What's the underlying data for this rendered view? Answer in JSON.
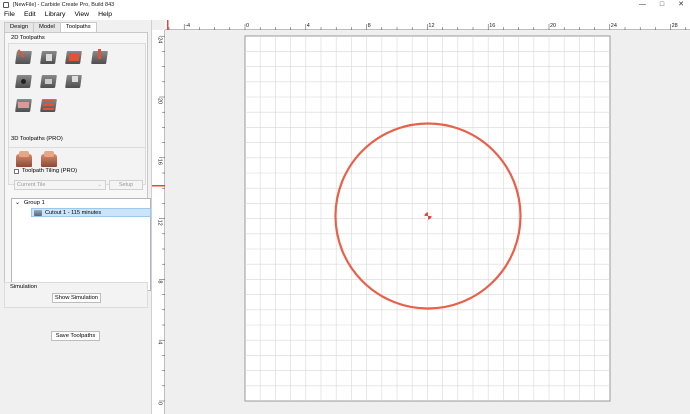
{
  "window": {
    "title": "[NewFile] - Carbide Create Pro, Build 843"
  },
  "menu": [
    "File",
    "Edit",
    "Library",
    "View",
    "Help"
  ],
  "tabs": [
    {
      "label": "Design"
    },
    {
      "label": "Model"
    },
    {
      "label": "Toolpaths",
      "active": true
    }
  ],
  "toolpaths_2d": {
    "label": "2D Toolpaths",
    "tools": [
      "contour-toolpath-icon",
      "pocket-toolpath-icon",
      "advanced-vcarve-icon",
      "vcarve-toolpath-icon",
      "drill-toolpath-icon",
      "rapid-adaptive-icon",
      "chamfer-toolpath-icon",
      "texture-toolpath-icon",
      "engrave-toolpath-icon",
      "thread-toolpath-icon"
    ]
  },
  "toolpaths_3d": {
    "label": "3D Toolpaths (PRO)",
    "tools": [
      "3d-rough-icon",
      "3d-finish-icon"
    ]
  },
  "tiling": {
    "label": "Toolpath Tiling (PRO)",
    "checked": false,
    "tile_value": "Current Tile",
    "setup_label": "Setup"
  },
  "tree": {
    "group_label": "Group 1",
    "items": [
      {
        "label": "Cutout 1 - 115 minutes",
        "selected": true
      }
    ]
  },
  "simulation": {
    "label": "Simulation",
    "button": "Show Simulation"
  },
  "save_button": "Save Toolpaths",
  "rulers": {
    "x_ticks": [
      "-4",
      "0",
      "4",
      "8",
      "12",
      "16",
      "20",
      "24",
      "28"
    ],
    "y_ticks": [
      "24",
      "20",
      "16",
      "12",
      "8",
      "4",
      "0"
    ]
  },
  "colors": {
    "circle": "#e8604a",
    "accent": "#e8463a",
    "selection": "#cce4f7"
  }
}
